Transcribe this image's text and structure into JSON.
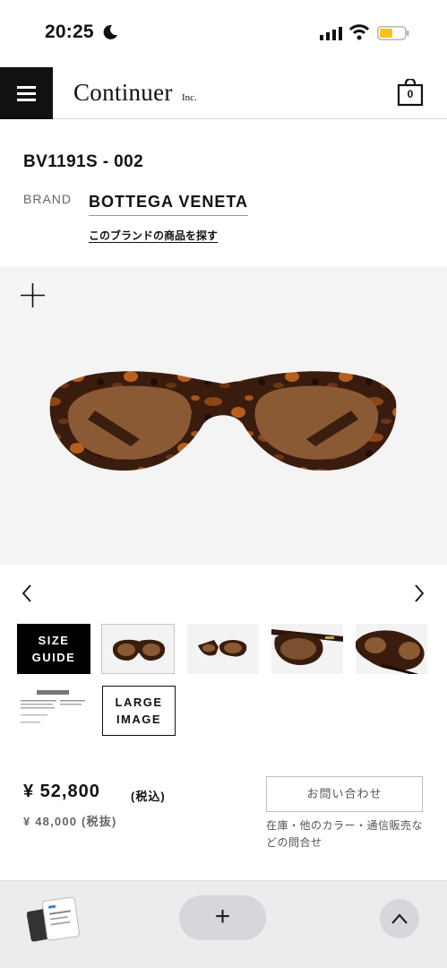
{
  "status_bar": {
    "time": "20:25",
    "icons": [
      "moon-icon",
      "signal-icon",
      "wifi-icon",
      "battery-icon"
    ],
    "battery_color": "#f5c518"
  },
  "header": {
    "logo": "Continuer",
    "logo_suffix": "Inc.",
    "cart_count": "0",
    "icons": [
      "menu-icon",
      "cart-icon"
    ]
  },
  "product": {
    "code": "BV1191S - 002",
    "brand_label": "BRAND",
    "brand_name": "BOTTEGA VENETA",
    "brand_link": "このブランドの商品を探す"
  },
  "gallery": {
    "size_guide_line1": "SIZE",
    "size_guide_line2": "GUIDE",
    "large_image_line1": "LARGE",
    "large_image_line2": "IMAGE",
    "icons": [
      "zoom-plus-icon",
      "chevron-left-icon",
      "chevron-right-icon"
    ]
  },
  "price": {
    "main": "¥ 52,800",
    "tax_included": "(税込)",
    "sub": "¥ 48,000 (税抜)",
    "inquiry_button": "お問い合わせ",
    "inquiry_note": "在庫・他のカラー・通信販売などの問合せ"
  },
  "toolbar": {
    "plus_label": "+",
    "icons": [
      "tabs-preview-icon",
      "chevron-up-icon"
    ]
  },
  "colors": {
    "tortoise_dark": "#2b150c",
    "tortoise_mid": "#6b3414",
    "tortoise_light": "#c0661c",
    "lens": "#8a5a34",
    "accent_black": "#000000"
  }
}
